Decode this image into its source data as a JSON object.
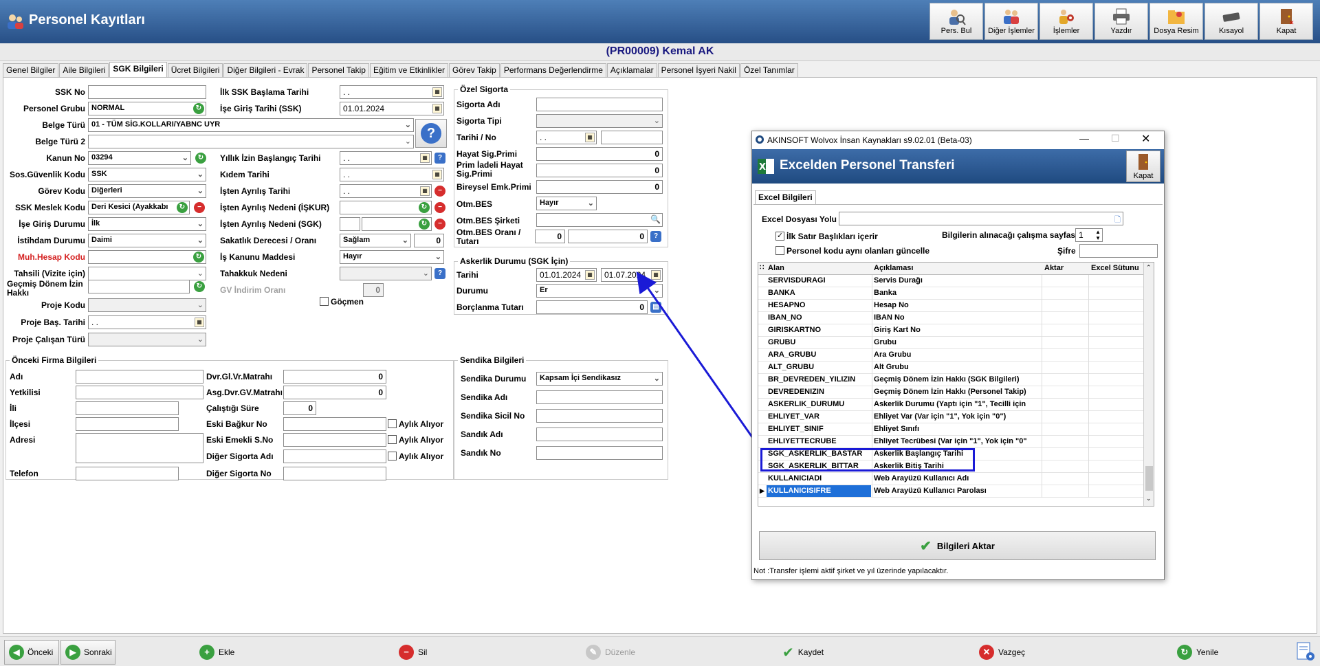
{
  "app": {
    "title": "Personel Kayıtları"
  },
  "toolbar": [
    {
      "label": "Pers. Bul",
      "icon": "person-search-icon"
    },
    {
      "label": "Diğer İşlemler",
      "icon": "people-icon"
    },
    {
      "label": "İşlemler",
      "icon": "people-gear-icon"
    },
    {
      "label": "Yazdır",
      "icon": "printer-icon"
    },
    {
      "label": "Dosya Resim",
      "icon": "folder-image-icon"
    },
    {
      "label": "Kısayol",
      "icon": "keyboard-icon"
    },
    {
      "label": "Kapat",
      "icon": "exit-door-icon"
    }
  ],
  "record_title": "(PR00009) Kemal AK",
  "tabs": [
    "Genel Bilgiler",
    "Aile Bilgileri",
    "SGK Bilgileri",
    "Ücret Bilgileri",
    "Diğer Bilgileri - Evrak",
    "Personel Takip",
    "Eğitim ve Etkinlikler",
    "Görev Takip",
    "Performans Değerlendirme",
    "Açıklamalar",
    "Personel İşyeri Nakil",
    "Özel Tanımlar"
  ],
  "active_tab": "SGK Bilgileri",
  "left": {
    "ssk_no": {
      "label": "SSK No",
      "value": ""
    },
    "personel_grubu": {
      "label": "Personel Grubu",
      "value": "NORMAL"
    },
    "belge_turu": {
      "label": "Belge Türü",
      "value": "01 - TÜM SİG.KOLLARI/YABNC UYR"
    },
    "belge_turu2": {
      "label": "Belge Türü 2",
      "value": ""
    },
    "kanun_no": {
      "label": "Kanun No",
      "value": "03294"
    },
    "sos_guv": {
      "label": "Sos.Güvenlik Kodu",
      "value": "SSK"
    },
    "gorev_kodu": {
      "label": "Görev Kodu",
      "value": "Diğerleri"
    },
    "ssk_meslek": {
      "label": "SSK Meslek Kodu",
      "value": "Deri Kesici (Ayakkabı"
    },
    "ise_giris_durumu": {
      "label": "İşe Giriş Durumu",
      "value": "İlk"
    },
    "istihdam": {
      "label": "İstihdam Durumu",
      "value": "Daimi"
    },
    "muh_hesap": {
      "label": "Muh.Hesap Kodu",
      "value": ""
    },
    "tahsili": {
      "label": "Tahsili (Vizite için)",
      "value": ""
    },
    "gecmis_donem": {
      "label": "Geçmiş Dönem İzin Hakkı",
      "value": ""
    },
    "proje_kodu": {
      "label": "Proje Kodu",
      "value": ""
    },
    "proje_bas": {
      "label": "Proje Baş. Tarihi",
      "value": ". ."
    },
    "proje_calisan": {
      "label": "Proje Çalışan Türü",
      "value": ""
    }
  },
  "mid": {
    "ilk_ssk": {
      "label": "İlk SSK Başlama Tarihi",
      "value": ". ."
    },
    "ise_giris_ssk": {
      "label": "İşe Giriş Tarihi (SSK)",
      "value": "01.01.2024"
    },
    "yillik_izin": {
      "label": "Yıllık İzin Başlangıç Tarihi",
      "value": ". ."
    },
    "kidem": {
      "label": "Kıdem Tarihi",
      "value": ". ."
    },
    "isten_ayrilis": {
      "label": "İşten Ayrılış Tarihi",
      "value": ". ."
    },
    "ayrilis_iskur": {
      "label": "İşten Ayrılış Nedeni (İŞKUR)",
      "value": ""
    },
    "ayrilis_sgk": {
      "label": "İşten Ayrılış Nedeni (SGK)",
      "value": ""
    },
    "sakatlik": {
      "label": "Sakatlık Derecesi / Oranı",
      "value": "Sağlam",
      "oran": "0"
    },
    "is_kanunu": {
      "label": "İş Kanunu Maddesi",
      "value": "Hayır"
    },
    "tahakkuk": {
      "label": "Tahakkuk Nedeni",
      "value": ""
    },
    "gv_indirim": {
      "label": "GV İndirim Oranı",
      "value": "0"
    },
    "gocmen": {
      "label": "Göçmen"
    }
  },
  "ozel_sigorta": {
    "title": "Özel Sigorta",
    "sigorta_adi": {
      "label": "Sigorta Adı",
      "value": ""
    },
    "sigorta_tipi": {
      "label": "Sigorta Tipi",
      "value": ""
    },
    "tarihi_no": {
      "label": "Tarihi / No",
      "value": ". .",
      "no": ""
    },
    "hayat": {
      "label": "Hayat Sig.Primi",
      "value": "0"
    },
    "prim_iadeli": {
      "label": "Prim İadeli Hayat Sig.Primi",
      "value": "0"
    },
    "bireysel": {
      "label": "Bireysel Emk.Primi",
      "value": "0"
    },
    "otm_bes": {
      "label": "Otm.BES",
      "value": "Hayır"
    },
    "otm_bes_sirketi": {
      "label": "Otm.BES Şirketi",
      "value": ""
    },
    "otm_bes_orani": {
      "label": "Otm.BES Oranı / Tutarı",
      "oran": "0",
      "tutar": "0"
    }
  },
  "askerlik": {
    "title": "Askerlik Durumu (SGK İçin)",
    "tarihi": {
      "label": "Tarihi",
      "start": "01.01.2024",
      "end": "01.07.2024"
    },
    "durumu": {
      "label": "Durumu",
      "value": "Er"
    },
    "borclanma": {
      "label": "Borçlanma Tutarı",
      "value": "0"
    }
  },
  "onceki_firma": {
    "title": "Önceki Firma Bilgileri",
    "adi": {
      "label": "Adı",
      "value": ""
    },
    "yetkilisi": {
      "label": "Yetkilisi",
      "value": ""
    },
    "ili": {
      "label": "İli",
      "value": ""
    },
    "ilcesi": {
      "label": "İlçesi",
      "value": ""
    },
    "adresi": {
      "label": "Adresi",
      "value": ""
    },
    "telefon": {
      "label": "Telefon",
      "value": ""
    },
    "dvr_gl": {
      "label": "Dvr.Gl.Vr.Matrahı",
      "value": "0"
    },
    "asg_dvr": {
      "label": "Asg.Dvr.GV.Matrahı",
      "value": "0"
    },
    "calistigi": {
      "label": "Çalıştığı Süre",
      "value": "0"
    },
    "eski_bagkur": {
      "label": "Eski Bağkur No",
      "value": ""
    },
    "eski_emekli": {
      "label": "Eski Emekli S.No",
      "value": ""
    },
    "diger_sig_adi": {
      "label": "Diğer Sigorta Adı",
      "value": ""
    },
    "diger_sig_no": {
      "label": "Diğer Sigorta No",
      "value": ""
    },
    "aylik": "Aylık Alıyor"
  },
  "sendika": {
    "title": "Sendika Bilgileri",
    "durumu": {
      "label": "Sendika Durumu",
      "value": "Kapsam İçi Sendikasız"
    },
    "adi": {
      "label": "Sendika Adı",
      "value": ""
    },
    "sicil": {
      "label": "Sendika Sicil No",
      "value": ""
    },
    "sandik_adi": {
      "label": "Sandık Adı",
      "value": ""
    },
    "sandik_no": {
      "label": "Sandık No",
      "value": ""
    }
  },
  "dialog": {
    "window_title": "AKINSOFT Wolvox İnsan Kaynakları s9.02.01 (Beta-03)",
    "banner_title": "Excelden Personel Transferi",
    "close_label": "Kapat",
    "tab": "Excel Bilgileri",
    "file_label": "Excel Dosyası Yolu",
    "file_value": "",
    "first_row_label": "İlk Satır Başlıkları içerir",
    "update_label": "Personel kodu aynı olanları güncelle",
    "sheet_label": "Bilgilerin alınacağı çalışma sayfası",
    "sheet_value": "1",
    "password_label": "Şifre",
    "columns": [
      "Alan",
      "Açıklaması",
      "Aktar",
      "Excel Sütunu"
    ],
    "rows": [
      [
        "SERVISDURAGI",
        "Servis Durağı"
      ],
      [
        "BANKA",
        "Banka"
      ],
      [
        "HESAPNO",
        "Hesap No"
      ],
      [
        "IBAN_NO",
        "IBAN No"
      ],
      [
        "GIRISKARTNO",
        "Giriş Kart No"
      ],
      [
        "GRUBU",
        "Grubu"
      ],
      [
        "ARA_GRUBU",
        "Ara Grubu"
      ],
      [
        "ALT_GRUBU",
        "Alt Grubu"
      ],
      [
        "BR_DEVREDEN_YILIZIN",
        "Geçmiş Dönem İzin Hakkı (SGK Bilgileri)"
      ],
      [
        "DEVREDENIZIN",
        "Geçmiş Dönem İzin Hakkı (Personel Takip)"
      ],
      [
        "ASKERLIK_DURUMU",
        "Askerlik Durumu (Yaptı için \"1\", Tecilli için"
      ],
      [
        "EHLIYET_VAR",
        "Ehliyet Var (Var için \"1\", Yok için \"0\")"
      ],
      [
        "EHLIYET_SINIF",
        "Ehliyet Sınıfı"
      ],
      [
        "EHLIYETTECRUBE",
        "Ehliyet Tecrübesi (Var için \"1\", Yok için \"0\""
      ],
      [
        "SGK_ASKERLIK_BASTAR",
        "Askerlik Başlangıç Tarihi"
      ],
      [
        "SGK_ASKERLIK_BITTAR",
        "Askerlik Bitiş Tarihi"
      ],
      [
        "KULLANICIADI",
        "Web Arayüzü Kullanıcı Adı"
      ],
      [
        "KULLANICISIFRE",
        "Web Arayüzü Kullanıcı Parolası"
      ]
    ],
    "transfer_label": "Bilgileri Aktar",
    "note": "Not :Transfer işlemi aktif şirket ve yıl üzerinde yapılacaktır."
  },
  "bottom": {
    "onceki": "Önceki",
    "sonraki": "Sonraki",
    "ekle": "Ekle",
    "sil": "Sil",
    "duzenle": "Düzenle",
    "kaydet": "Kaydet",
    "vazgec": "Vazgeç",
    "yenile": "Yenile"
  }
}
